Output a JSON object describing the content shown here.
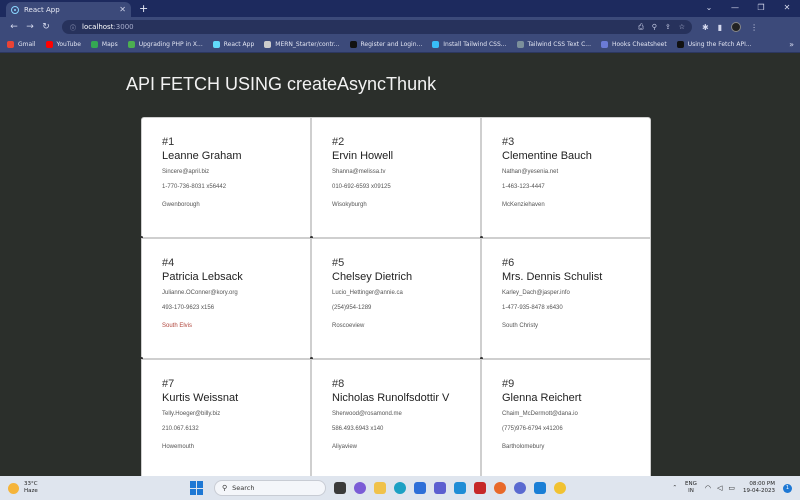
{
  "browser": {
    "tab": {
      "title": "React App",
      "close": "✕"
    },
    "new_tab": "+",
    "window_controls": {
      "chevron": "⌄",
      "minimize": "—",
      "maximize": "❐",
      "close": "✕"
    },
    "nav": {
      "back": "←",
      "forward": "→",
      "reload": "↻"
    },
    "url": {
      "host": "localhost",
      "port": ":3000"
    },
    "bookmarks": [
      {
        "label": "Gmail",
        "color": "#ea4335"
      },
      {
        "label": "YouTube",
        "color": "#ff0000"
      },
      {
        "label": "Maps",
        "color": "#34a853"
      },
      {
        "label": "Upgrading PHP in X...",
        "color": "#4caf50"
      },
      {
        "label": "React App",
        "color": "#61dafb"
      },
      {
        "label": "MERN_Starter/contr...",
        "color": "#cccccc"
      },
      {
        "label": "Register and Login...",
        "color": "#111111"
      },
      {
        "label": "Install Tailwind CSS...",
        "color": "#38bdf8"
      },
      {
        "label": "Tailwind CSS Text C...",
        "color": "#7b8f9b"
      },
      {
        "label": "Hooks Cheatsheet",
        "color": "#6b7bd6"
      },
      {
        "label": "Using the Fetch API...",
        "color": "#111111"
      }
    ],
    "bookmarks_more": "»"
  },
  "page": {
    "title": "API FETCH USING createAsyncThunk",
    "users": [
      {
        "num": "#1",
        "name": "Leanne Graham",
        "email": "Sincere@april.biz",
        "phone": "1-770-736-8031 x56442",
        "city": "Gwenborough",
        "city_red": false
      },
      {
        "num": "#2",
        "name": "Ervin Howell",
        "email": "Shanna@melissa.tv",
        "phone": "010-692-6593 x09125",
        "city": "Wisokyburgh",
        "city_red": false
      },
      {
        "num": "#3",
        "name": "Clementine Bauch",
        "email": "Nathan@yesenia.net",
        "phone": "1-463-123-4447",
        "city": "McKenziehaven",
        "city_red": false
      },
      {
        "num": "#4",
        "name": "Patricia Lebsack",
        "email": "Julianne.OConner@kory.org",
        "phone": "493-170-9623 x156",
        "city": "South Elvis",
        "city_red": true
      },
      {
        "num": "#5",
        "name": "Chelsey Dietrich",
        "email": "Lucio_Hettinger@annie.ca",
        "phone": "(254)954-1289",
        "city": "Roscoeview",
        "city_red": false
      },
      {
        "num": "#6",
        "name": "Mrs. Dennis Schulist",
        "email": "Karley_Dach@jasper.info",
        "phone": "1-477-935-8478 x6430",
        "city": "South Christy",
        "city_red": false
      },
      {
        "num": "#7",
        "name": "Kurtis Weissnat",
        "email": "Telly.Hoeger@billy.biz",
        "phone": "210.067.6132",
        "city": "Howemouth",
        "city_red": false
      },
      {
        "num": "#8",
        "name": "Nicholas Runolfsdottir V",
        "email": "Sherwood@rosamond.me",
        "phone": "586.493.6943 x140",
        "city": "Aliyaview",
        "city_red": false
      },
      {
        "num": "#9",
        "name": "Glenna Reichert",
        "email": "Chaim_McDermott@dana.io",
        "phone": "(775)976-6794 x41206",
        "city": "Bartholomebury",
        "city_red": false
      }
    ]
  },
  "taskbar": {
    "weather": {
      "temp": "33°C",
      "cond": "Haze"
    },
    "search": {
      "label": "Search"
    },
    "lang": {
      "line1": "ENG",
      "line2": "IN"
    },
    "clock": {
      "time": "08:00 PM",
      "date": "19-04-2023"
    },
    "notif_count": "1"
  }
}
